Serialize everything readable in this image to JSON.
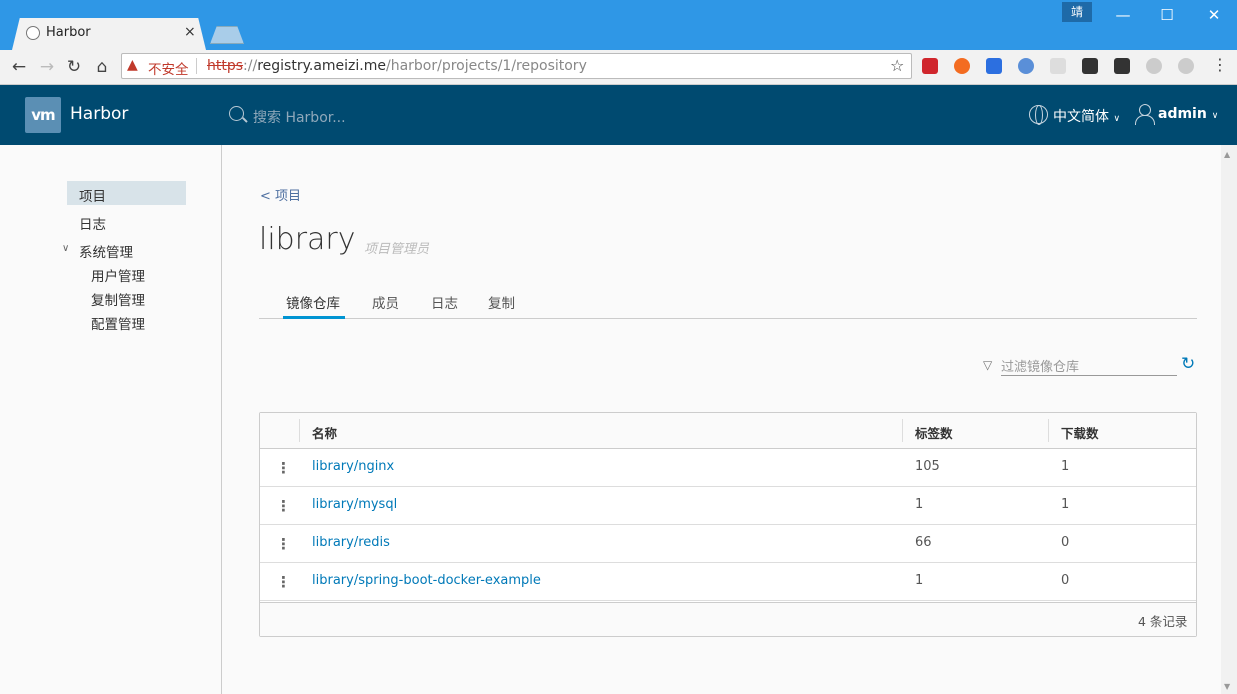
{
  "browser": {
    "tab_title": "Harbor",
    "tab_close": "×",
    "user_badge": "靖",
    "win_minimize": "—",
    "win_maximize": "☐",
    "win_close": "✕",
    "security_label": "不安全",
    "url_scheme": "https",
    "url_sep": "://",
    "url_host": "registry.ameizi.me",
    "url_path": "/harbor/projects/1/repository"
  },
  "app": {
    "brand_logo": "vm",
    "brand": "Harbor",
    "search_placeholder": "搜索 Harbor...",
    "language": "中文简体",
    "username": "admin"
  },
  "sidebar": {
    "items": [
      {
        "label": "项目"
      },
      {
        "label": "日志"
      },
      {
        "label": "系统管理"
      }
    ],
    "sub_items": [
      {
        "label": "用户管理"
      },
      {
        "label": "复制管理"
      },
      {
        "label": "配置管理"
      }
    ]
  },
  "main": {
    "back_link": "< 项目",
    "project_name": "library",
    "project_role": "项目管理员",
    "tabs": [
      {
        "label": "镜像仓库",
        "active": true
      },
      {
        "label": "成员"
      },
      {
        "label": "日志"
      },
      {
        "label": "复制"
      }
    ],
    "filter_placeholder": "过滤镜像仓库",
    "table": {
      "headers": [
        "名称",
        "标签数",
        "下载数"
      ],
      "rows": [
        {
          "name": "library/nginx",
          "tags": "105",
          "pulls": "1"
        },
        {
          "name": "library/mysql",
          "tags": "1",
          "pulls": "1"
        },
        {
          "name": "library/redis",
          "tags": "66",
          "pulls": "0"
        },
        {
          "name": "library/spring-boot-docker-example",
          "tags": "1",
          "pulls": "0"
        }
      ],
      "footer": "4 条记录"
    }
  },
  "colors": {
    "header_bg": "#004a70",
    "link": "#0079b8",
    "tab_active": "#0094d2"
  }
}
